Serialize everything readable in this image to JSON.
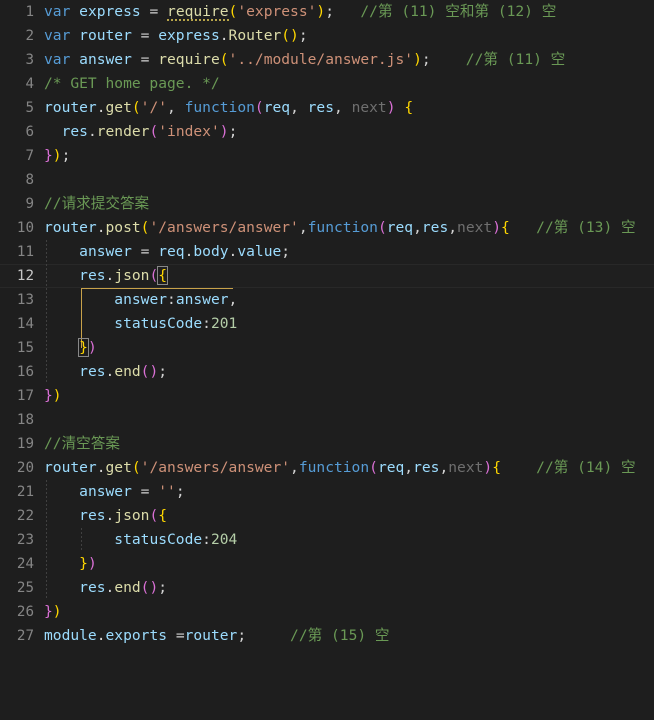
{
  "editor": {
    "language": "javascript",
    "theme": "dark-plus",
    "background": "#1e1e1e",
    "active_line": 12,
    "colors": {
      "keyword": "#569cd6",
      "variable": "#9cdcfe",
      "function": "#dcdcaa",
      "string": "#ce9178",
      "number": "#b5cea8",
      "comment": "#6a9955",
      "operator": "#d4d4d4",
      "line_number": "#858585",
      "bracket_gold": "#ffd700",
      "bracket_magenta": "#da70d6",
      "bracket_blue": "#179fff",
      "bracket_guide": "#c8a24a",
      "indent_guide": "#404040",
      "unused_param": "#6f6f6f",
      "active_line_bg": "#1f1f1f"
    }
  },
  "lines": [
    {
      "n": "1",
      "text": "var express = require('express');   //第 (11) 空和第 (12) 空"
    },
    {
      "n": "2",
      "text": "var router = express.Router();"
    },
    {
      "n": "3",
      "text": "var answer = require('../module/answer.js');    //第 (11) 空"
    },
    {
      "n": "4",
      "text": "/* GET home page. */"
    },
    {
      "n": "5",
      "text": "router.get('/', function(req, res, next) {"
    },
    {
      "n": "6",
      "text": "  res.render('index');"
    },
    {
      "n": "7",
      "text": "});"
    },
    {
      "n": "8",
      "text": ""
    },
    {
      "n": "9",
      "text": "//请求提交答案"
    },
    {
      "n": "10",
      "text": "router.post('/answers/answer',function(req,res,next){   //第 (13) 空"
    },
    {
      "n": "11",
      "text": "    answer = req.body.value;"
    },
    {
      "n": "12",
      "text": "    res.json({"
    },
    {
      "n": "13",
      "text": "        answer:answer,"
    },
    {
      "n": "14",
      "text": "        statusCode:201"
    },
    {
      "n": "15",
      "text": "    })"
    },
    {
      "n": "16",
      "text": "    res.end();"
    },
    {
      "n": "17",
      "text": "})"
    },
    {
      "n": "18",
      "text": ""
    },
    {
      "n": "19",
      "text": "//清空答案"
    },
    {
      "n": "20",
      "text": "router.get('/answers/answer',function(req,res,next){    //第 (14) 空"
    },
    {
      "n": "21",
      "text": "    answer = '';"
    },
    {
      "n": "22",
      "text": "    res.json({"
    },
    {
      "n": "23",
      "text": "        statusCode:204"
    },
    {
      "n": "24",
      "text": "    })"
    },
    {
      "n": "25",
      "text": "    res.end();"
    },
    {
      "n": "26",
      "text": "})"
    },
    {
      "n": "27",
      "text": "module.exports =router;     //第 (15) 空"
    }
  ],
  "tokens": {
    "kw_var": "var",
    "kw_function": "function",
    "id_express": "express",
    "id_router": "router",
    "id_answer": "answer",
    "id_req": "req",
    "id_res": "res",
    "id_next": "next",
    "id_module": "module",
    "id_exports": "exports",
    "id_body": "body",
    "id_value": "value",
    "id_answer_key": "answer",
    "id_statusCode": "statusCode",
    "fn_require": "require",
    "fn_Router": "Router",
    "fn_get": "get",
    "fn_post": "post",
    "fn_render": "render",
    "fn_json": "json",
    "fn_end": "end",
    "str_express": "'express'",
    "str_module_path": "'../module/answer.js'",
    "str_root": "'/'",
    "str_index": "'index'",
    "str_answers_answer": "'/answers/answer'",
    "str_empty": "''",
    "num_201": "201",
    "num_204": "204",
    "cmt_block_get_home": "/* GET home page. */",
    "cmt_l1": "//第 (11) 空和第 (12) 空",
    "cmt_l3": "//第 (11) 空",
    "cmt_l9": "//请求提交答案",
    "cmt_l10": "//第 (13) 空",
    "cmt_l19": "//清空答案",
    "cmt_l20": "//第 (14) 空",
    "cmt_l27": "//第 (15) 空"
  }
}
